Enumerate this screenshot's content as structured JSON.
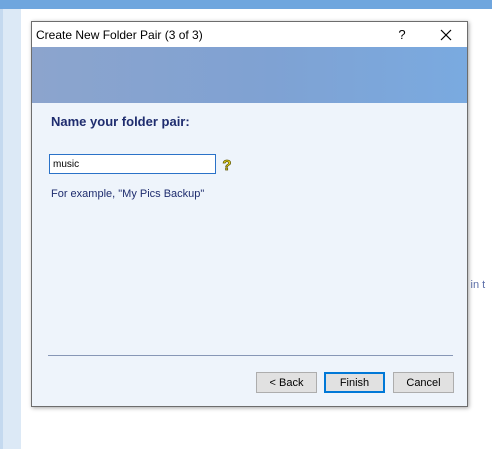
{
  "background": {
    "partial_text": "s in t"
  },
  "dialog": {
    "title": "Create New Folder Pair (3 of 3)",
    "help_label": "?",
    "close_icon": "close-icon",
    "heading": "Name your folder pair:",
    "input": {
      "value": "music",
      "placeholder": ""
    },
    "help_icon": "question-mark-icon",
    "example_text": "For example, \"My Pics Backup\"",
    "buttons": {
      "back": "< Back",
      "finish": "Finish",
      "cancel": "Cancel"
    }
  },
  "colors": {
    "accent": "#0078d7",
    "heading": "#1e2c6e",
    "banner": "#7fa2d3",
    "dialog_bg": "#eef4fb"
  }
}
